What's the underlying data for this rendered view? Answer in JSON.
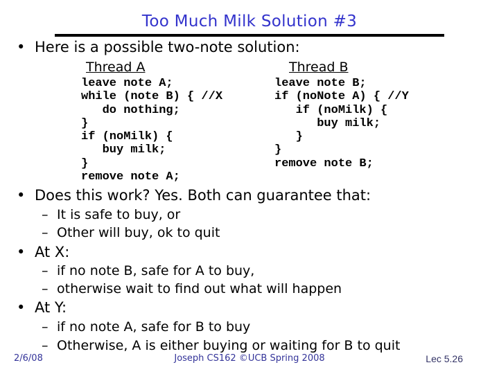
{
  "slide": {
    "title": "Too Much Milk Solution #3",
    "title_color": "#3333cc",
    "bullets": [
      {
        "text": "Here is a possible two-note solution:"
      },
      {
        "text": "Does this work? Yes. Both can guarantee that:",
        "subitems": [
          "It is safe to buy, or",
          "Other will buy, ok to quit"
        ]
      },
      {
        "text": "At X:",
        "subitems": [
          "if no note B, safe for A to buy,",
          "otherwise wait to find out what will happen"
        ]
      },
      {
        "text": "At Y:",
        "subitems": [
          "if no note A, safe for B to buy",
          "Otherwise, A is either buying or waiting for B to quit"
        ]
      }
    ],
    "bullet_glyph": "•",
    "dash_glyph": "–",
    "thread_a": {
      "heading": "Thread A",
      "code": "leave note A;\nwhile (note B) { //X\n   do nothing;\n}\nif (noMilk) {\n   buy milk;\n}\nremove note A;"
    },
    "thread_b": {
      "heading": "Thread B",
      "code": "leave note B;\nif (noNote A) { //Y\n   if (noMilk) {\n      buy milk;\n   }\n}\nremove note B;"
    }
  },
  "footer": {
    "date": "2/6/08",
    "course": "Joseph CS162 ©UCB Spring 2008",
    "lecture": "Lec 5.26"
  }
}
